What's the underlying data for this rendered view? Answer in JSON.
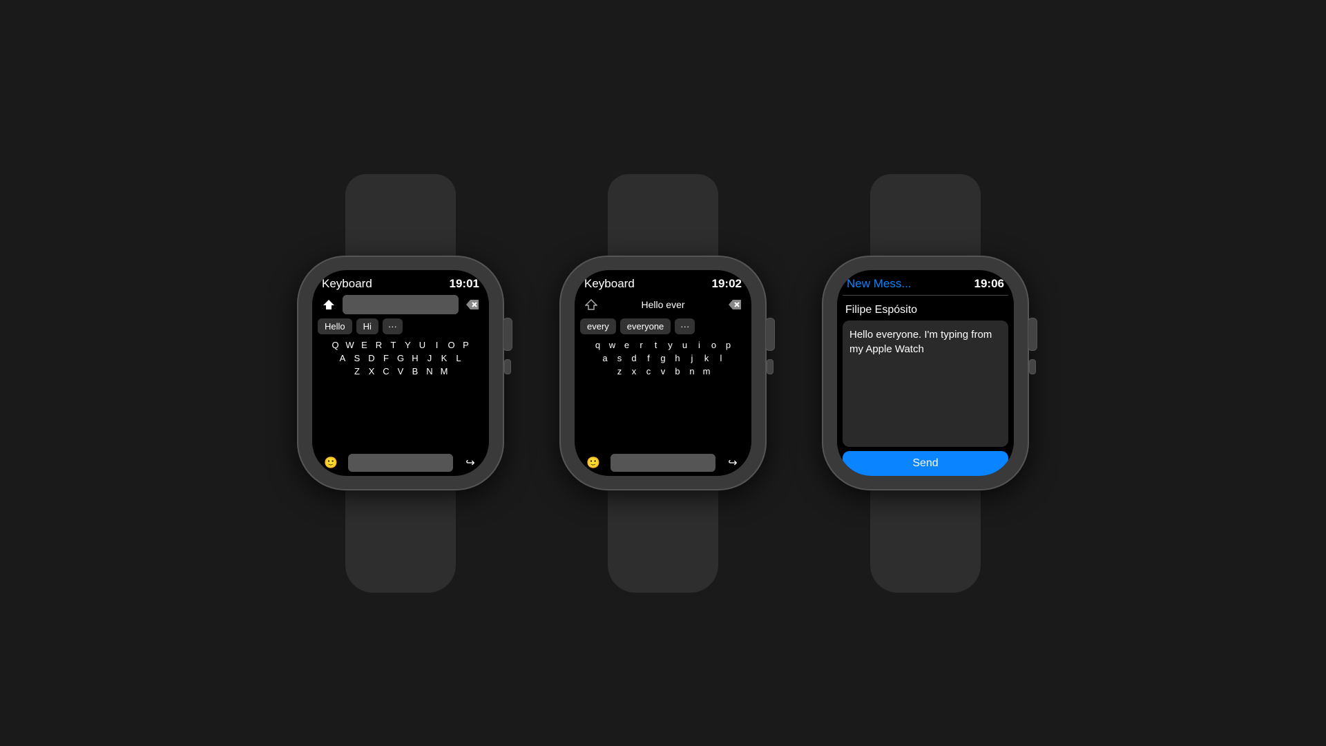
{
  "background": "#1a1a1a",
  "watches": [
    {
      "id": "watch1",
      "header": {
        "title": "Keyboard",
        "title_color": "white",
        "time": "19:01"
      },
      "input_text": "",
      "suggestions": [
        "Hello",
        "Hi",
        "···"
      ],
      "keyboard_rows": [
        [
          "Q",
          "W",
          "E",
          "R",
          "T",
          "Y",
          "U",
          "I",
          "O",
          "P"
        ],
        [
          "A",
          "S",
          "D",
          "F",
          "G",
          "H",
          "J",
          "K",
          "L"
        ],
        [
          "Z",
          "X",
          "C",
          "V",
          "B",
          "N",
          "M"
        ]
      ]
    },
    {
      "id": "watch2",
      "header": {
        "title": "Keyboard",
        "title_color": "white",
        "time": "19:02"
      },
      "input_text": "Hello ever",
      "suggestions": [
        "every",
        "everyone",
        "···"
      ],
      "keyboard_rows": [
        [
          "q",
          "w",
          "e",
          "r",
          "t",
          "y",
          "u",
          "i",
          "o",
          "p"
        ],
        [
          "a",
          "s",
          "d",
          "f",
          "g",
          "h",
          "j",
          "k",
          "l"
        ],
        [
          "z",
          "x",
          "c",
          "v",
          "b",
          "n",
          "m"
        ]
      ]
    },
    {
      "id": "watch3",
      "header": {
        "title": "New Mess...",
        "title_color": "blue",
        "time": "19:06"
      },
      "contact": "Filipe Espósito",
      "message": "Hello everyone. I'm typing from my Apple Watch",
      "send_label": "Send"
    }
  ]
}
